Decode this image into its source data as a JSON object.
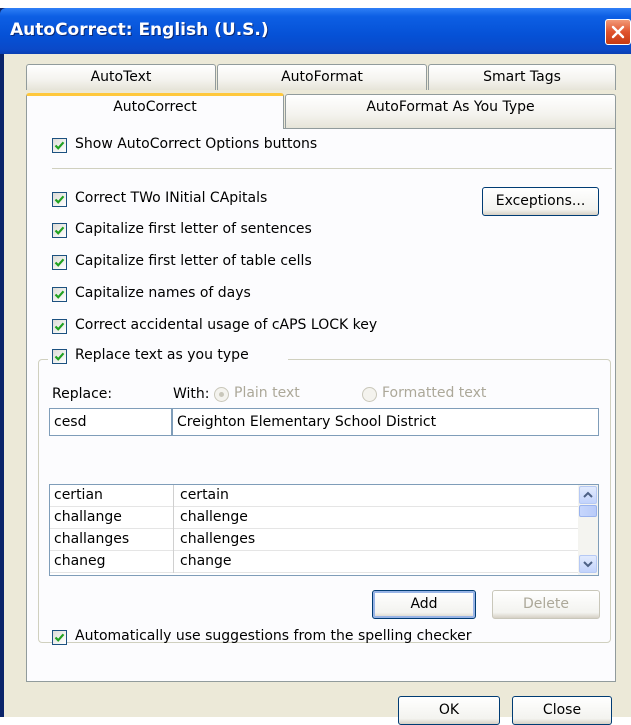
{
  "window": {
    "title": "AutoCorrect: English (U.S.)"
  },
  "tabs": {
    "row1": [
      "AutoText",
      "AutoFormat",
      "Smart Tags"
    ],
    "row2": [
      "AutoCorrect",
      "AutoFormat As You Type"
    ],
    "active": "AutoCorrect"
  },
  "options": {
    "show_buttons": {
      "label": "Show AutoCorrect Options buttons",
      "checked": true
    },
    "two_initials": {
      "label": "Correct TWo INitial CApitals",
      "checked": true
    },
    "first_letter_sentences": {
      "label": "Capitalize first letter of sentences",
      "checked": true
    },
    "first_letter_cells": {
      "label": "Capitalize first letter of table cells",
      "checked": true
    },
    "names_of_days": {
      "label": "Capitalize names of days",
      "checked": true
    },
    "caps_lock": {
      "label": "Correct accidental usage of cAPS LOCK key",
      "checked": true
    },
    "replace_text": {
      "label": "Replace text as you type",
      "checked": true
    },
    "spelling_suggestions": {
      "label": "Automatically use suggestions from the spelling checker",
      "checked": true
    }
  },
  "buttons": {
    "exceptions": "Exceptions...",
    "add": "Add",
    "delete": "Delete",
    "ok": "OK",
    "close": "Close"
  },
  "replace_section": {
    "replace_label": "Replace:",
    "with_label": "With:",
    "plain_text": "Plain text",
    "formatted_text": "Formatted text",
    "replace_value": "cesd",
    "with_value": "Creighton Elementary School District"
  },
  "entries": [
    {
      "replace": "certian",
      "with": "certain"
    },
    {
      "replace": "challange",
      "with": "challenge"
    },
    {
      "replace": "challanges",
      "with": "challenges"
    },
    {
      "replace": "chaneg",
      "with": "change"
    }
  ],
  "icons": {
    "close": "close-x-icon",
    "check": "check-icon",
    "scroll_up": "scroll-up-arrow-icon",
    "scroll_down": "scroll-down-arrow-icon"
  },
  "colors": {
    "titlebar": "#0551d6",
    "client": "#ece9d8",
    "active_tab_accent": "#ffc83c",
    "close_button": "#e0532d"
  }
}
